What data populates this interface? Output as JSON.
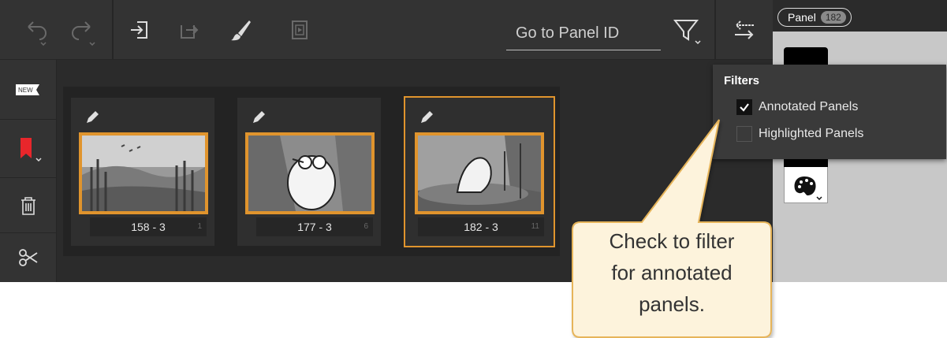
{
  "toolbar": {
    "goto_placeholder": "Go to Panel ID",
    "undo_icon": "undo-icon",
    "redo_icon": "redo-icon",
    "import_icon": "import-icon",
    "export_icon": "export-icon",
    "brush_icon": "brush-icon",
    "playback_icon": "playback-icon",
    "filter_icon": "filter-icon",
    "swap_icon": "swap-icon"
  },
  "sidebar": {
    "items": [
      {
        "name": "new-panel",
        "label": "NEW"
      },
      {
        "name": "bookmark",
        "label": ""
      },
      {
        "name": "delete",
        "label": ""
      },
      {
        "name": "cut",
        "label": ""
      }
    ]
  },
  "panels": [
    {
      "label": "158 - 3",
      "index": "1",
      "selected": false
    },
    {
      "label": "177 - 3",
      "index": "6",
      "selected": false
    },
    {
      "label": "182 - 3",
      "index": "11",
      "selected": true
    }
  ],
  "right_panel": {
    "pill_label": "Panel",
    "pill_count": "182"
  },
  "filters": {
    "title": "Filters",
    "options": [
      {
        "label": "Annotated Panels",
        "checked": true
      },
      {
        "label": "Highlighted Panels",
        "checked": false
      }
    ]
  },
  "callout": {
    "lines": [
      "Check to filter",
      "for annotated",
      "panels."
    ]
  },
  "colors": {
    "accent": "#e0942d",
    "bookmark": "#e8262b",
    "callout_fill": "#fdf3dc",
    "callout_border": "#e6b45a"
  }
}
